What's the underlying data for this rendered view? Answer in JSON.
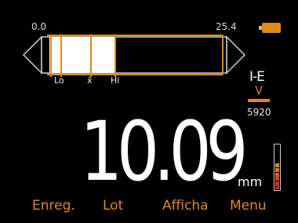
{
  "scale": {
    "min": "0.0",
    "max": "25.4"
  },
  "bar": {
    "value_mm": 10.09,
    "lo_mm": 0.0,
    "hi_mm": 25.4
  },
  "markers": {
    "lo": "Lo",
    "mean": "x̄",
    "hi": "Hi"
  },
  "mode": {
    "name": "I-E",
    "sub": "V",
    "velocity": "5920"
  },
  "reading": {
    "value": "10.09",
    "unit": "mm"
  },
  "softkeys": [
    "Enreg.",
    "Lot",
    "Afficha",
    "Menu"
  ],
  "colors": {
    "accent": "#e08a14",
    "bg": "#000000",
    "text": "#ffffff"
  },
  "icons": {
    "battery": "battery-icon",
    "signal": "signal-meter-icon"
  },
  "signal_level": 0.55
}
